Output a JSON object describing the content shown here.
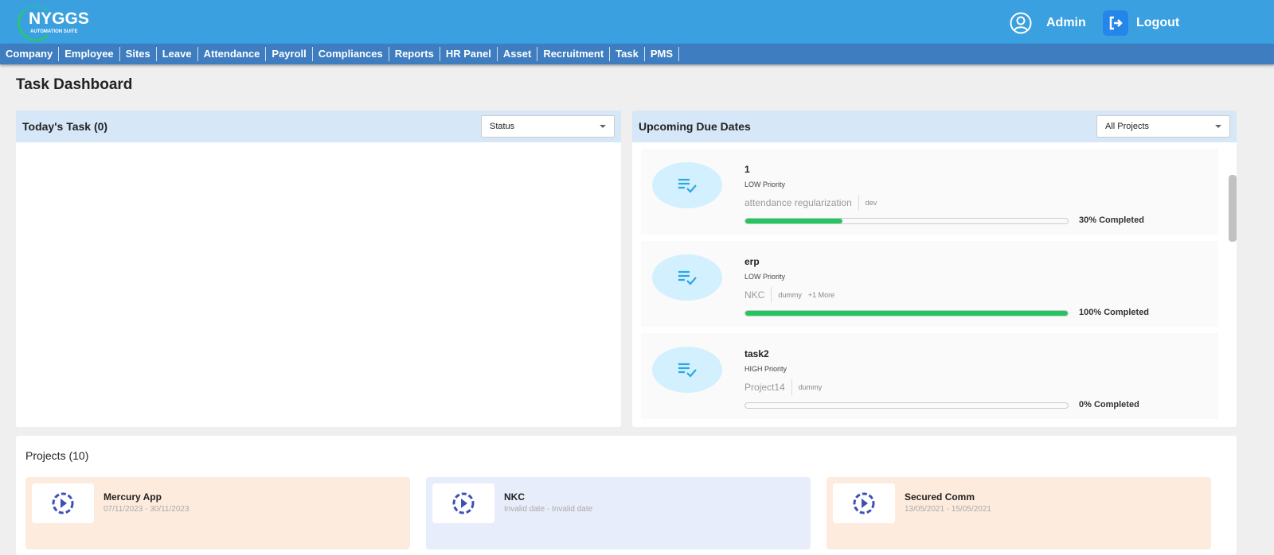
{
  "header": {
    "logo_text": "NYGGS",
    "logo_subtext": "AUTOMATION SUITE",
    "user": "Admin",
    "logout": "Logout"
  },
  "nav": [
    "Company",
    "Employee",
    "Sites",
    "Leave",
    "Attendance",
    "Payroll",
    "Compliances",
    "Reports",
    "HR Panel",
    "Asset",
    "Recruitment",
    "Task",
    "PMS"
  ],
  "page_title": "Task Dashboard",
  "today": {
    "title": "Today's Task (0)",
    "filter": "Status"
  },
  "upcoming": {
    "title": "Upcoming Due Dates",
    "filter": "All Projects",
    "tasks": [
      {
        "name": "1",
        "priority": "LOW Priority",
        "project": "attendance regularization",
        "tag": "dev",
        "more": "",
        "progress": 30,
        "label": "30% Completed"
      },
      {
        "name": "erp",
        "priority": "LOW Priority",
        "project": "NKC",
        "tag": "dummy",
        "more": "+1 More",
        "progress": 100,
        "label": "100% Completed"
      },
      {
        "name": "task2",
        "priority": "HIGH Priority",
        "project": "Project14",
        "tag": "dummy",
        "more": "",
        "progress": 0,
        "label": "0% Completed"
      }
    ]
  },
  "projects": {
    "title": "Projects (10)",
    "items": [
      {
        "name": "Mercury App",
        "dates": "07/11/2023 - 30/11/2023",
        "color": "#fdecdd"
      },
      {
        "name": "NKC",
        "dates": "Invalid date - Invalid date",
        "color": "#e8edfb"
      },
      {
        "name": "Secured Comm",
        "dates": "13/05/2021 - 15/05/2021",
        "color": "#fdecdd"
      }
    ]
  }
}
